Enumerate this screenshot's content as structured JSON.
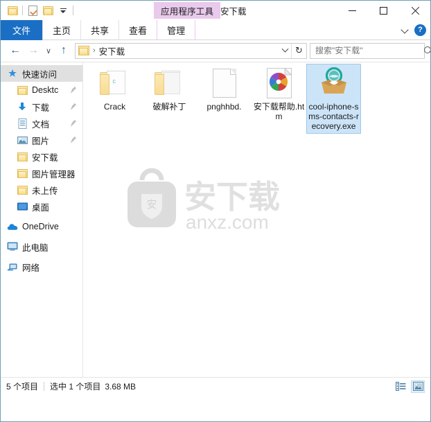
{
  "window": {
    "title": "安下载",
    "contextual_tab_banner": "应用程序工具",
    "minimize_label": "最小化",
    "maximize_label": "最大化",
    "close_label": "关闭"
  },
  "quick_access_toolbar": {
    "items": [
      {
        "name": "folder-icon",
        "label": "属性"
      },
      {
        "name": "properties-icon",
        "label": "属性"
      },
      {
        "name": "new-folder-icon",
        "label": "新建文件夹"
      },
      {
        "name": "customize-caret",
        "label": "自定义快速访问工具栏"
      }
    ]
  },
  "ribbon": {
    "tabs": [
      {
        "label": "文件",
        "type": "file"
      },
      {
        "label": "主页",
        "type": "plain"
      },
      {
        "label": "共享",
        "type": "plain"
      },
      {
        "label": "查看",
        "type": "plain"
      },
      {
        "label": "管理",
        "type": "contextual"
      }
    ],
    "expand_label": "展开功能区",
    "help_label": "?"
  },
  "address_bar": {
    "back_label": "←",
    "forward_label": "→",
    "recent_label": "∨",
    "up_label": "↑",
    "breadcrumb_separator": "›",
    "breadcrumb": [
      "安下载"
    ],
    "dropdown_label": "∨",
    "refresh_label": "↻"
  },
  "search": {
    "placeholder": "搜索\"安下载\"",
    "value": "",
    "icon": "search-icon"
  },
  "sidebar": {
    "items": [
      {
        "label": "快速访问",
        "icon": "pin-star-icon",
        "selected": true,
        "indent": false,
        "pinned": false
      },
      {
        "label": "Desktc",
        "icon": "folder-icon",
        "selected": false,
        "indent": true,
        "pinned": true
      },
      {
        "label": "下载",
        "icon": "download-icon",
        "selected": false,
        "indent": true,
        "pinned": true
      },
      {
        "label": "文档",
        "icon": "documents-icon",
        "selected": false,
        "indent": true,
        "pinned": true
      },
      {
        "label": "图片",
        "icon": "pictures-icon",
        "selected": false,
        "indent": true,
        "pinned": true
      },
      {
        "label": "安下载",
        "icon": "folder-icon",
        "selected": false,
        "indent": true,
        "pinned": false
      },
      {
        "label": "图片管理器",
        "icon": "folder-icon",
        "selected": false,
        "indent": true,
        "pinned": false
      },
      {
        "label": "未上传",
        "icon": "folder-icon",
        "selected": false,
        "indent": true,
        "pinned": false
      },
      {
        "label": "桌面",
        "icon": "desktop-icon",
        "selected": false,
        "indent": true,
        "pinned": false
      },
      {
        "label": "OneDrive",
        "icon": "onedrive-icon",
        "selected": false,
        "indent": false,
        "pinned": false
      },
      {
        "label": "此电脑",
        "icon": "this-pc-icon",
        "selected": false,
        "indent": false,
        "pinned": false
      },
      {
        "label": "网络",
        "icon": "network-icon",
        "selected": false,
        "indent": false,
        "pinned": false
      }
    ]
  },
  "files": [
    {
      "name": "Crack",
      "icon": "folder-c-icon",
      "selected": false
    },
    {
      "name": "破解补丁",
      "icon": "folder-icon",
      "selected": false
    },
    {
      "name": "pnghhbd.",
      "icon": "blank-doc-icon",
      "selected": false
    },
    {
      "name": "安下载帮助.htm",
      "icon": "html-chrome-icon",
      "selected": false
    },
    {
      "name": "cool-iphone-sms-contacts-recovery.exe",
      "icon": "exe-box-icon",
      "selected": true
    }
  ],
  "watermark": {
    "brand": "安下载",
    "domain": "anxz.com",
    "logo_glyph": "安"
  },
  "status_bar": {
    "item_count": "5 个项目",
    "selection": "选中 1 个项目",
    "size": "3.68 MB",
    "views": [
      {
        "name": "details-view-button",
        "label": "详细信息"
      },
      {
        "name": "large-icons-view-button",
        "label": "大图标",
        "active": true
      }
    ]
  },
  "colors": {
    "accent": "#1a6fc4",
    "contextual_tab": "#e9c9ec",
    "selection_fill": "#cce4f7",
    "selection_border": "#9dc8ea",
    "folder_yellow": "#fbd978",
    "window_border": "#6f9fb5"
  }
}
